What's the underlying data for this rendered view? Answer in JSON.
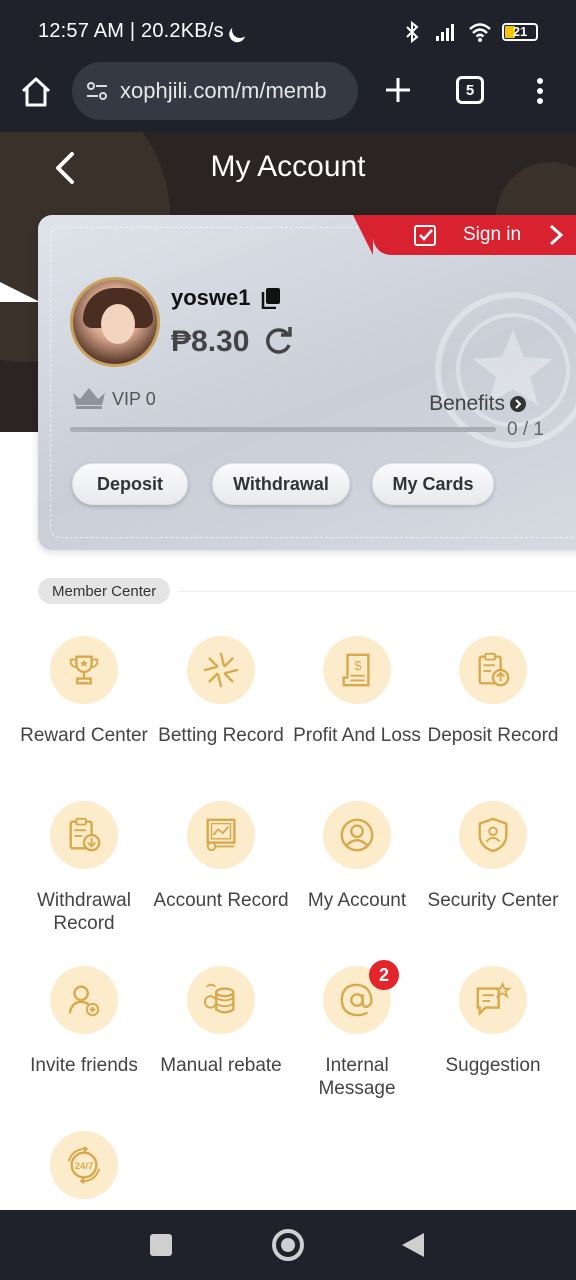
{
  "status_bar": {
    "time": "12:57 AM | 20.2KB/s",
    "battery": "21"
  },
  "browser": {
    "url": "xophjili.com/m/memb",
    "tab_count": "5"
  },
  "header": {
    "title": "My Account"
  },
  "account": {
    "sign_in_label": "Sign in",
    "username": "yoswe1",
    "balance": "₱8.30",
    "vip_label": "VIP 0",
    "benefits_label": "Benefits",
    "progress_text": "0 / 1",
    "progress_fraction": 0.0,
    "buttons": {
      "deposit": "Deposit",
      "withdrawal": "Withdrawal",
      "my_cards": "My Cards"
    }
  },
  "member_center": {
    "title": "Member Center",
    "items": [
      {
        "label": "Reward Center",
        "icon": "trophy-icon"
      },
      {
        "label": "Betting Record",
        "icon": "star-burst-icon"
      },
      {
        "label": "Profit And Loss",
        "icon": "receipt-dollar-icon"
      },
      {
        "label": "Deposit Record",
        "icon": "clipboard-upload-icon"
      },
      {
        "label": "Withdrawal Record",
        "icon": "clipboard-download-icon"
      },
      {
        "label": "Account Record",
        "icon": "monitor-chart-icon"
      },
      {
        "label": "My Account",
        "icon": "user-circle-icon"
      },
      {
        "label": "Security Center",
        "icon": "shield-user-icon"
      },
      {
        "label": "Invite friends",
        "icon": "user-add-icon"
      },
      {
        "label": "Manual rebate",
        "icon": "coins-icon"
      },
      {
        "label": "Internal Message",
        "icon": "at-sign-icon",
        "badge": "2"
      },
      {
        "label": "Suggestion",
        "icon": "chat-star-icon"
      },
      {
        "label": "",
        "icon": "support-24-7-icon"
      }
    ]
  },
  "colors": {
    "accent_red": "#d8222f",
    "icon_bg": "#fdeccc",
    "icon_stroke": "#d9a84a",
    "badge_red": "#e3242b"
  }
}
